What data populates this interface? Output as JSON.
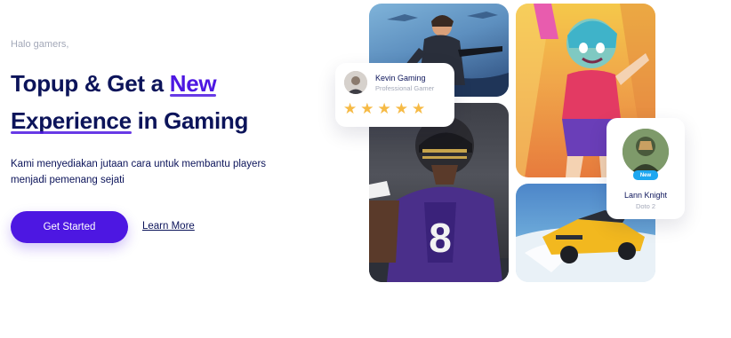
{
  "hero": {
    "greeting": "Halo gamers,",
    "headline": {
      "part1": "Topup & Get a ",
      "highlight": "New",
      "part2": "Experience",
      "part3": " in Gaming"
    },
    "description": "Kami menyediakan jutaan cara untuk membantu players menjadi pemenang sejati",
    "primary_button": "Get Started",
    "secondary_link": "Learn More"
  },
  "gallery": {
    "tiles": [
      {
        "name": "battlefield-soldier",
        "icon": "game-art-image"
      },
      {
        "name": "football-player",
        "icon": "game-art-image"
      },
      {
        "name": "hero-character",
        "icon": "game-art-image"
      },
      {
        "name": "racing-car",
        "icon": "game-art-image"
      }
    ],
    "kevin_card": {
      "name": "Kevin Gaming",
      "role": "Professional Gamer",
      "rating": 5,
      "star_color": "#f6ba45"
    },
    "lann_card": {
      "name": "Lann Knight",
      "role": "Doto 2",
      "badge": "New",
      "badge_color": "#1ea7f0"
    }
  },
  "colors": {
    "primary": "#4d17e2",
    "heading": "#0c145a",
    "muted": "#a3a8b8"
  }
}
